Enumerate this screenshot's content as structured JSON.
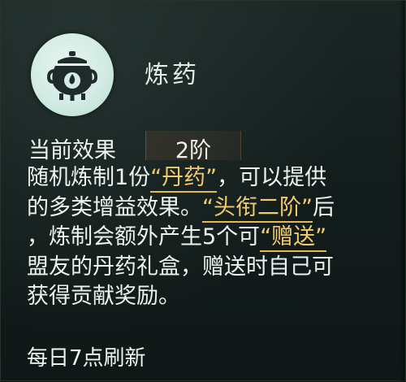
{
  "skill": {
    "icon": "cauldron-icon",
    "title": "炼药"
  },
  "level": {
    "label": "当前效果",
    "value": "2阶"
  },
  "description": {
    "line1_a": "随机炼制1份",
    "line1_hl": "“丹药”",
    "line1_b": "，可以提供",
    "line2_a": "的多类增益效果。",
    "line2_hl": "“头衔二阶”",
    "line2_b": "后",
    "line3_a": "，炼制会额外产生5个可",
    "line3_hl": "“赠送”",
    "line4": "盟友的丹药礼盒，赠送时自己可",
    "line5": "获得贡献奖励。"
  },
  "refresh_text": "每日7点刷新",
  "colors": {
    "highlight": "#f3cc6a",
    "text": "#eef2f0",
    "icon_bg": "#d2ebe4",
    "icon_fg": "#1f2b2a"
  }
}
